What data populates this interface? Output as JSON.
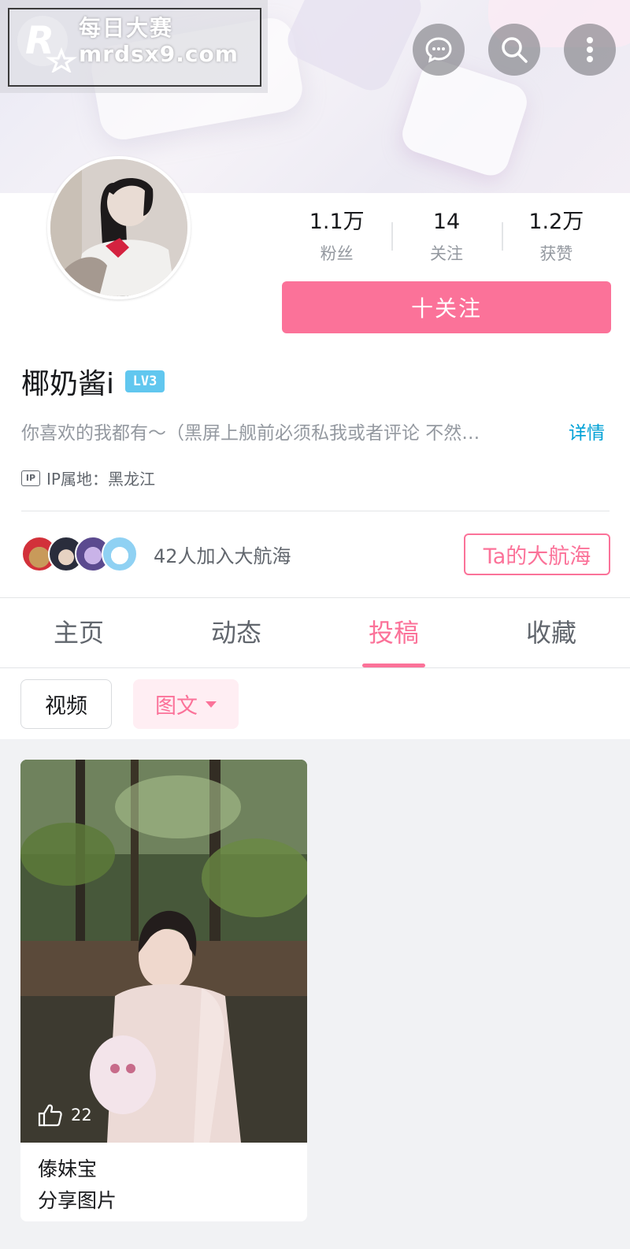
{
  "watermark": {
    "line1": "每日大赛",
    "line2": "mrdsx9.com"
  },
  "header_icons": [
    "chat-bubble-icon",
    "search-icon",
    "more-vertical-icon"
  ],
  "profile": {
    "username": "椰奶酱i",
    "level": "LV3",
    "bio": "你喜欢的我都有～（黑屏上舰前必须私我或者评论 不然…",
    "detail_link": "详情",
    "ip_location": "IP属地：黑龙江",
    "ip_icon": "IP",
    "stats": [
      {
        "value": "1.1万",
        "label": "粉丝"
      },
      {
        "value": "14",
        "label": "关注"
      },
      {
        "value": "1.2万",
        "label": "获赞"
      }
    ],
    "follow_label": "十关注"
  },
  "guard": {
    "text": "42人加入大航海",
    "button": "Ta的大航海"
  },
  "tabs": [
    {
      "label": "主页",
      "active": false
    },
    {
      "label": "动态",
      "active": false
    },
    {
      "label": "投稿",
      "active": true
    },
    {
      "label": "收藏",
      "active": false
    }
  ],
  "filters": {
    "video": "视频",
    "image_text": "图文"
  },
  "card": {
    "likes": "22",
    "title": "傣妹宝",
    "subtitle": "分享图片"
  },
  "colors": {
    "accent": "#fb7299",
    "link": "#00a1d6",
    "level": "#61c7ef"
  }
}
